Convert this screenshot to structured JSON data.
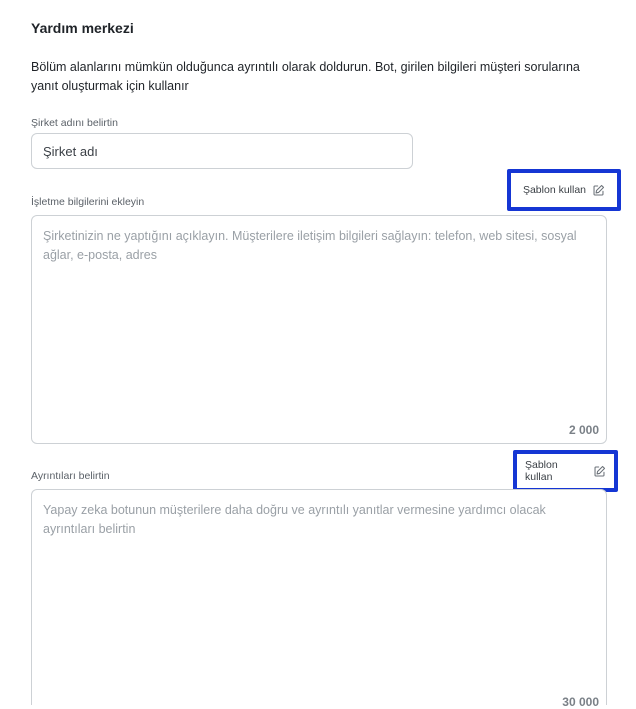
{
  "section": {
    "title": "Yardım merkezi",
    "description": "Bölüm alanlarını mümkün olduğunca ayrıntılı olarak doldurun. Bot, girilen bilgileri müşteri sorularına yanıt oluşturmak için kullanır"
  },
  "company": {
    "label": "Şirket adını belirtin",
    "placeholder": "Şirket adı"
  },
  "business": {
    "label": "İşletme bilgilerini ekleyin",
    "template_label": "Şablon kullan",
    "placeholder": "Şirketinizin ne yaptığını açıklayın. Müşterilere iletişim bilgileri sağlayın: telefon, web sitesi, sosyal ağlar, e-posta, adres",
    "counter": "2 000"
  },
  "details": {
    "label": "Ayrıntıları belirtin",
    "template_label": "Şablon kullan",
    "placeholder": "Yapay zeka botunun müşterilere daha doğru ve ayrıntılı yanıtlar vermesine yardımcı olacak ayrıntıları belirtin",
    "counter": "30 000"
  },
  "icons": {
    "template": "edit-pencil-icon"
  },
  "colors": {
    "highlight_border": "#1536d4",
    "field_border": "#cdd1d5",
    "placeholder": "#9aa0a6"
  }
}
